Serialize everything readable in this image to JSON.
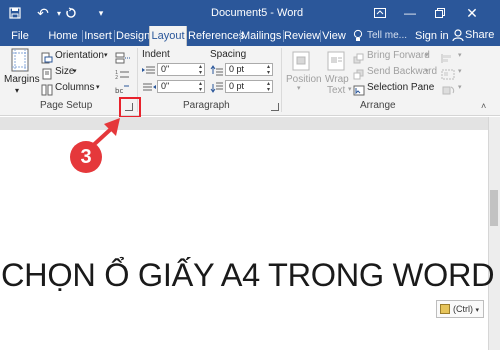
{
  "window": {
    "title": "Document5 - Word",
    "signin": "Sign in",
    "colors": {
      "brand": "#2b579a",
      "annotation": "#e5383b"
    }
  },
  "tabs": [
    {
      "label": "File"
    },
    {
      "label": "Home"
    },
    {
      "label": "Insert"
    },
    {
      "label": "Design"
    },
    {
      "label": "Layout",
      "active": true
    },
    {
      "label": "References"
    },
    {
      "label": "Mailings"
    },
    {
      "label": "Review"
    },
    {
      "label": "View"
    }
  ],
  "tellme": "Tell me...",
  "share": "Share",
  "ribbon": {
    "page_setup": {
      "margins": "Margins",
      "orientation": "Orientation",
      "size": "Size",
      "columns": "Columns",
      "label": "Page Setup"
    },
    "paragraph": {
      "indent": "Indent",
      "spacing": "Spacing",
      "indent_left": "0\"",
      "indent_right": "0\"",
      "spacing_before": "0 pt",
      "spacing_after": "0 pt",
      "label": "Paragraph"
    },
    "arrange": {
      "position": "Position",
      "wrap_text_1": "Wrap",
      "wrap_text_2": "Text",
      "bring_forward": "Bring Forward",
      "send_backward": "Send Backward",
      "selection_pane": "Selection Pane",
      "label": "Arrange"
    }
  },
  "annotation": {
    "step": "3"
  },
  "document": {
    "text": "CHỌN Ổ GIẤY A4 TRONG WORD",
    "paste_options": "(Ctrl)"
  }
}
